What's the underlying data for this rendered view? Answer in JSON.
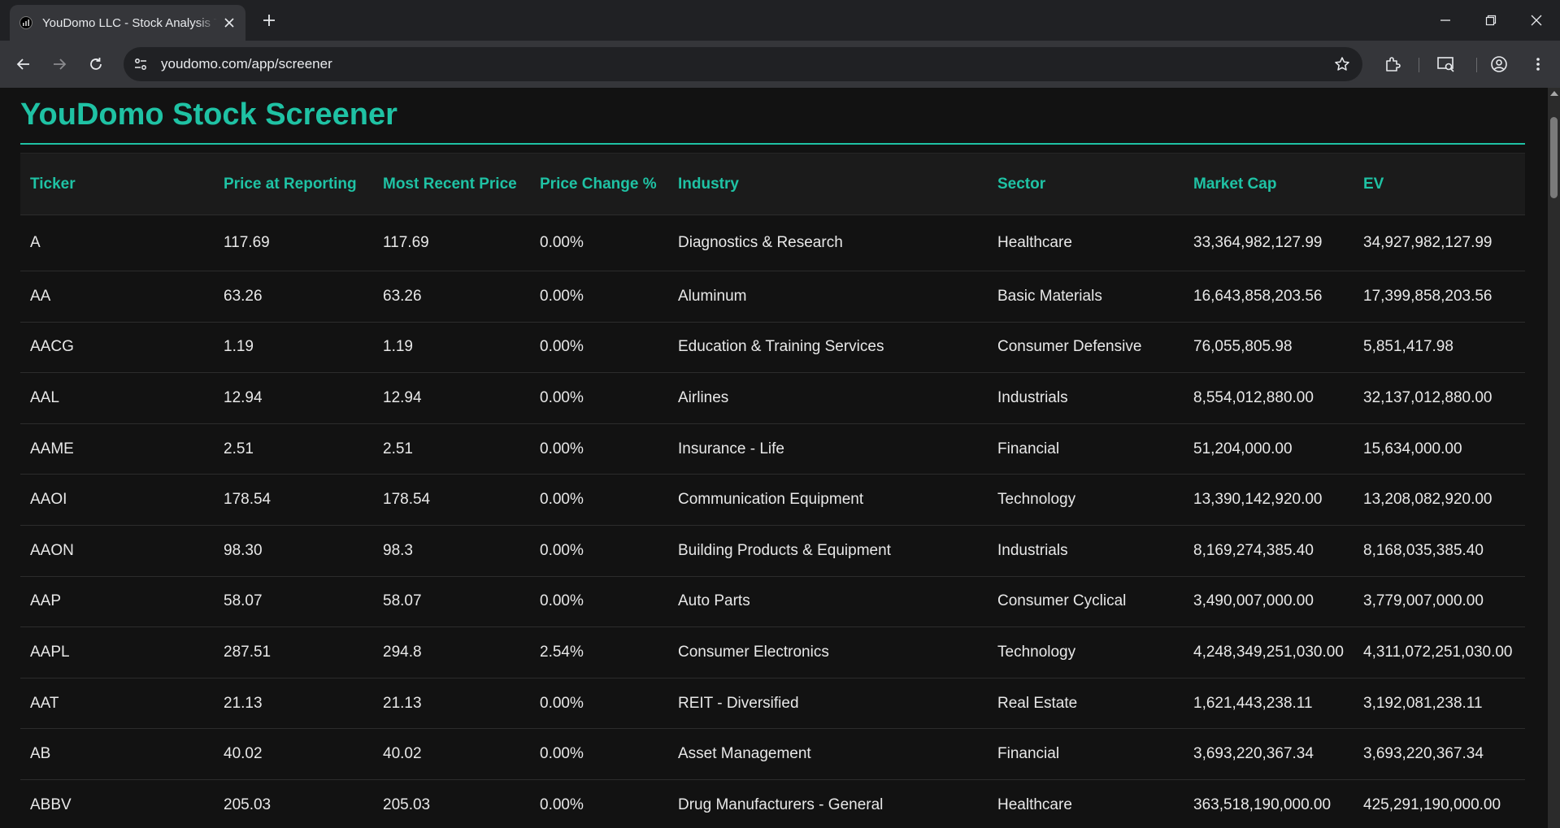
{
  "browser": {
    "tab_title": "YouDomo LLC - Stock Analysis Tool",
    "url": "youdomo.com/app/screener"
  },
  "page": {
    "title": "YouDomo Stock Screener"
  },
  "table": {
    "headers": [
      "Ticker",
      "Price at Reporting",
      "Most Recent Price",
      "Price Change %",
      "Industry",
      "Sector",
      "Market Cap",
      "EV"
    ],
    "rows": [
      [
        "A",
        "117.69",
        "117.69",
        "0.00%",
        "Diagnostics & Research",
        "Healthcare",
        "33,364,982,127.99",
        "34,927,982,127.99"
      ],
      [
        "AA",
        "63.26",
        "63.26",
        "0.00%",
        "Aluminum",
        "Basic Materials",
        "16,643,858,203.56",
        "17,399,858,203.56"
      ],
      [
        "AACG",
        "1.19",
        "1.19",
        "0.00%",
        "Education & Training Services",
        "Consumer Defensive",
        "76,055,805.98",
        "5,851,417.98"
      ],
      [
        "AAL",
        "12.94",
        "12.94",
        "0.00%",
        "Airlines",
        "Industrials",
        "8,554,012,880.00",
        "32,137,012,880.00"
      ],
      [
        "AAME",
        "2.51",
        "2.51",
        "0.00%",
        "Insurance - Life",
        "Financial",
        "51,204,000.00",
        "15,634,000.00"
      ],
      [
        "AAOI",
        "178.54",
        "178.54",
        "0.00%",
        "Communication Equipment",
        "Technology",
        "13,390,142,920.00",
        "13,208,082,920.00"
      ],
      [
        "AAON",
        "98.30",
        "98.3",
        "0.00%",
        "Building Products & Equipment",
        "Industrials",
        "8,169,274,385.40",
        "8,168,035,385.40"
      ],
      [
        "AAP",
        "58.07",
        "58.07",
        "0.00%",
        "Auto Parts",
        "Consumer Cyclical",
        "3,490,007,000.00",
        "3,779,007,000.00"
      ],
      [
        "AAPL",
        "287.51",
        "294.8",
        "2.54%",
        "Consumer Electronics",
        "Technology",
        "4,248,349,251,030.00",
        "4,311,072,251,030.00"
      ],
      [
        "AAT",
        "21.13",
        "21.13",
        "0.00%",
        "REIT - Diversified",
        "Real Estate",
        "1,621,443,238.11",
        "3,192,081,238.11"
      ],
      [
        "AB",
        "40.02",
        "40.02",
        "0.00%",
        "Asset Management",
        "Financial",
        "3,693,220,367.34",
        "3,693,220,367.34"
      ],
      [
        "ABBV",
        "205.03",
        "205.03",
        "0.00%",
        "Drug Manufacturers - General",
        "Healthcare",
        "363,518,190,000.00",
        "425,291,190,000.00"
      ]
    ]
  },
  "colors": {
    "accent": "#1fc2a4",
    "page_bg": "#121212",
    "header_bg": "#1b1b1b"
  }
}
